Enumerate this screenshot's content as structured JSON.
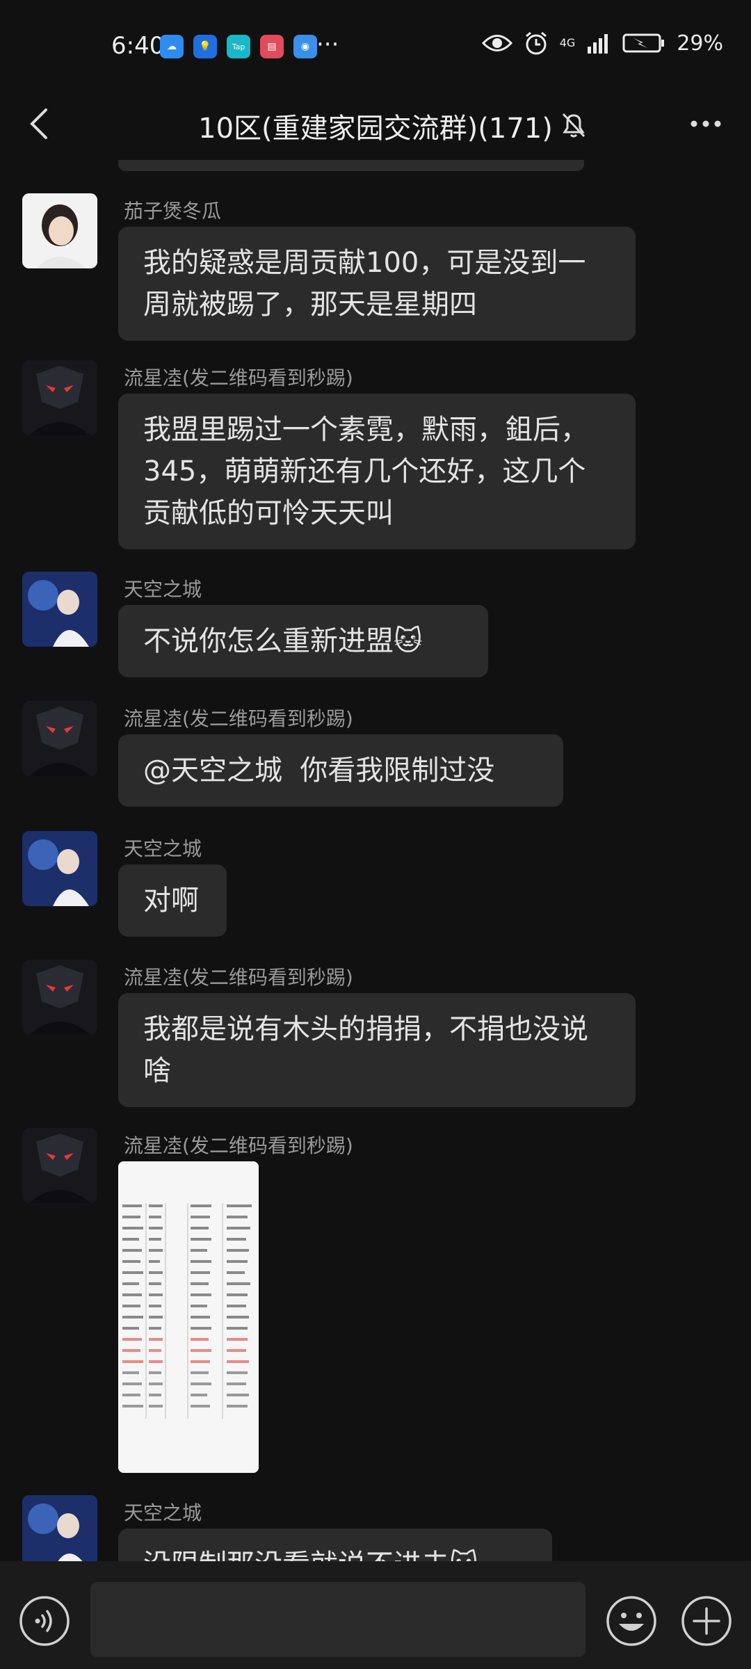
{
  "status": {
    "time": "6:40",
    "battery": "29%",
    "network": "4G",
    "dots": "···"
  },
  "header": {
    "title": "10区(重建家园交流群)(171)",
    "icons": [
      "back-icon",
      "mute-bell-icon",
      "more-icon"
    ]
  },
  "messages": [
    {
      "sender": "茄子煲冬瓜",
      "text": "我的疑惑是周贡献100，可是没到一周就被踢了，那天是星期四",
      "avatar": "portrait"
    },
    {
      "sender": "流星㓐(发二维码看到秒踢)",
      "text": "我盟里踢过一个素霓，默雨，鉏后，345，萌萌新还有几个还好，这几个贡献低的可怜天天叫",
      "avatar": "dark-mask"
    },
    {
      "sender": "天空之城",
      "text": "不说你怎么重新进盟",
      "emoji": "🐱",
      "avatar": "blue-girl"
    },
    {
      "sender": "流星㓐(发二维码看到秒踢)",
      "text": "@天空之城  你看我限制过没",
      "avatar": "dark-mask"
    },
    {
      "sender": "天空之城",
      "text": "对啊",
      "avatar": "blue-girl"
    },
    {
      "sender": "流星㓐(发二维码看到秒踢)",
      "text": "我都是说有木头的捐捐，不捐也没说啥",
      "avatar": "dark-mask"
    },
    {
      "sender": "流星㓐(发二维码看到秒踢)",
      "text": "",
      "image": "table-screenshot",
      "avatar": "dark-mask"
    },
    {
      "sender": "天空之城",
      "text": "没限制那没看就说不进去",
      "emoji": "🐱",
      "avatar": "blue-girl"
    }
  ],
  "colors": {
    "background": "#111112",
    "bubble": "#2b2b2b",
    "sender": "#9a9a9a"
  }
}
